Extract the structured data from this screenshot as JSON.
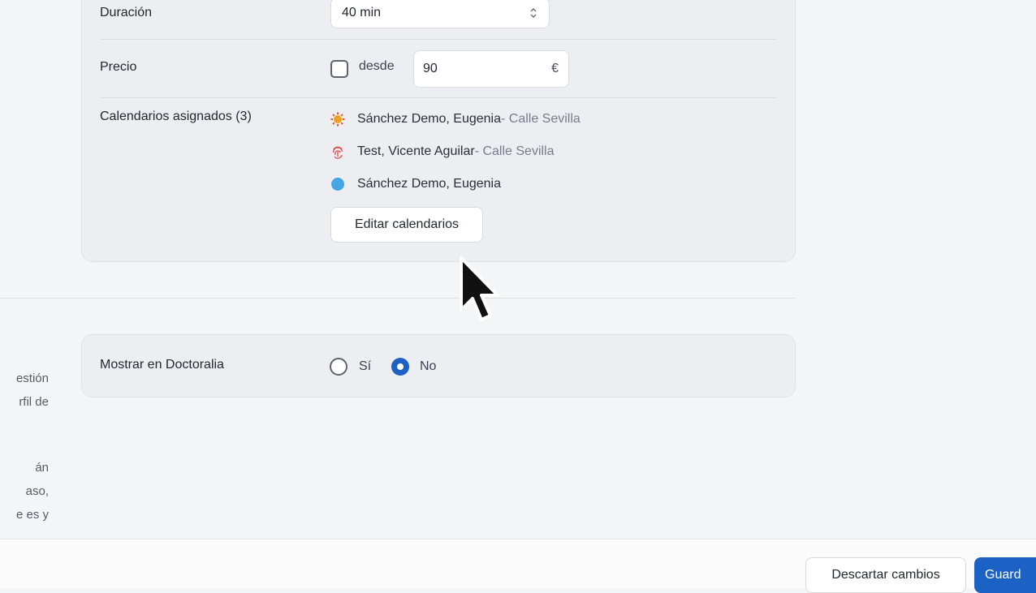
{
  "form": {
    "duration": {
      "label": "Duración",
      "value": "40 min"
    },
    "price": {
      "label": "Precio",
      "from_label": "desde",
      "value": "90",
      "currency": "€"
    },
    "calendars": {
      "label": "Calendarios asignados (3)",
      "items": [
        {
          "name": "Sánchez Demo, Eugenia",
          "location": " - Calle Sevilla",
          "icon": "sun-icon",
          "color": "#f0a020"
        },
        {
          "name": "Test, Vicente Aguilar",
          "location": " - Calle Sevilla",
          "icon": "fingerprint-icon",
          "color": "#e05252"
        },
        {
          "name": "Sánchez Demo, Eugenia",
          "location": "",
          "icon": "dot-icon",
          "color": "#46a5e5"
        }
      ],
      "edit_button": "Editar calendarios"
    },
    "doctoralia": {
      "label": "Mostrar en Doctoralia",
      "yes_label": "Sí",
      "no_label": "No",
      "selected": "No"
    }
  },
  "side_text": {
    "line1": "estión",
    "line2": "rfil de",
    "line3": "án",
    "line4": "aso,",
    "line5": "e es y"
  },
  "footer": {
    "discard_label": "Descartar cambios",
    "save_label": "Guard"
  },
  "colors": {
    "accent": "#1c62c4",
    "card_bg": "#eceef1"
  }
}
